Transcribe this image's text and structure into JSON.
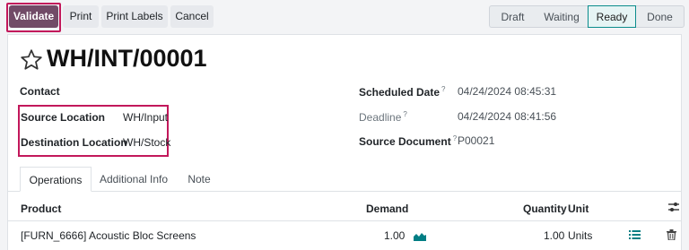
{
  "toolbar": {
    "validate": "Validate",
    "print": "Print",
    "print_labels": "Print Labels",
    "cancel": "Cancel"
  },
  "status_steps": [
    "Draft",
    "Waiting",
    "Ready",
    "Done"
  ],
  "active_status": "Ready",
  "record": {
    "title": "WH/INT/00001",
    "contact_label": "Contact",
    "source_location_label": "Source Location",
    "source_location_value": "WH/Input",
    "destination_location_label": "Destination Location",
    "destination_location_value": "WH/Stock",
    "scheduled_date_label": "Scheduled Date",
    "scheduled_date_value": "04/24/2024 08:45:31",
    "deadline_label": "Deadline",
    "deadline_value": "04/24/2024 08:41:56",
    "source_document_label": "Source Document",
    "source_document_value": "P00021",
    "help_mark": "?"
  },
  "tabs": [
    "Operations",
    "Additional Info",
    "Note"
  ],
  "table": {
    "headers": {
      "product": "Product",
      "demand": "Demand",
      "quantity": "Quantity",
      "unit": "Unit"
    },
    "rows": [
      {
        "product": "[FURN_6666] Acoustic Bloc Screens",
        "demand": "1.00",
        "quantity": "1.00",
        "unit": "Units"
      }
    ]
  },
  "icons": {
    "star": "star-icon",
    "forecast": "area-chart-icon",
    "details": "list-icon",
    "delete": "trash-icon",
    "optional_columns": "sliders-icon"
  },
  "colors": {
    "primary": "#714b67",
    "highlight": "#c2185b",
    "active_step": "#0a8c8c"
  }
}
